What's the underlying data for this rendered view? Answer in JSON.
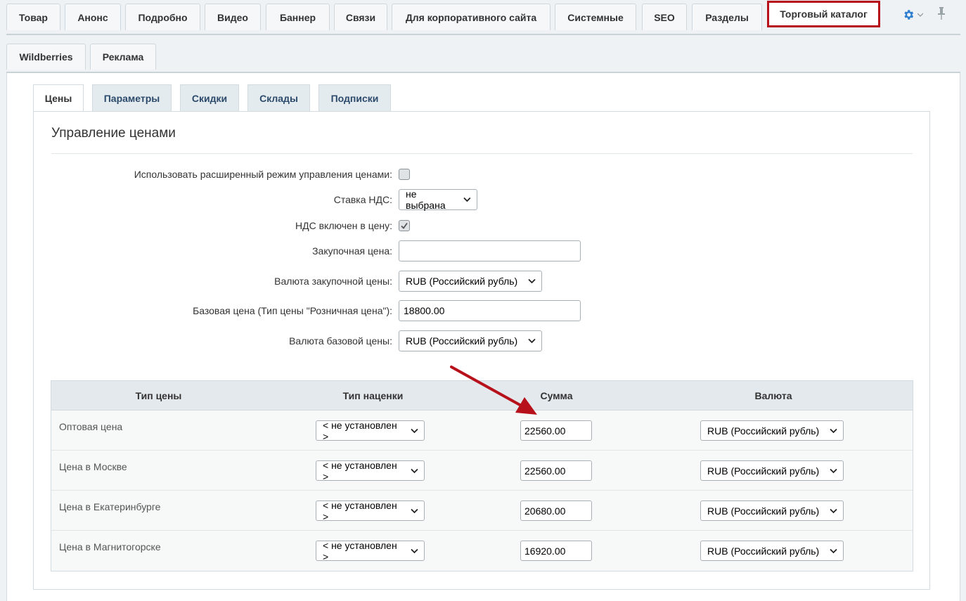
{
  "top_tabs": [
    "Товар",
    "Анонс",
    "Подробно",
    "Видео",
    "Баннер",
    "Связи",
    "Для корпоративного сайта",
    "Системные",
    "SEO",
    "Разделы",
    "Торговый каталог"
  ],
  "second_tabs": [
    "Wildberries",
    "Реклама"
  ],
  "sub_tabs": [
    "Цены",
    "Параметры",
    "Скидки",
    "Склады",
    "Подписки"
  ],
  "section_title": "Управление ценами",
  "fields": {
    "extended_mode_label": "Использовать расширенный режим управления ценами:",
    "extended_mode_checked": false,
    "vat_rate_label": "Ставка НДС:",
    "vat_rate_value": "не выбрана",
    "vat_included_label": "НДС включен в цену:",
    "vat_included_checked": true,
    "purchase_price_label": "Закупочная цена:",
    "purchase_price_value": "",
    "purchase_currency_label": "Валюта закупочной цены:",
    "purchase_currency_value": "RUB (Российский рубль)",
    "base_price_label": "Базовая цена (Тип цены \"Розничная цена\"):",
    "base_price_value": "18800.00",
    "base_currency_label": "Валюта базовой цены:",
    "base_currency_value": "RUB (Российский рубль)"
  },
  "price_table": {
    "headers": [
      "Тип цены",
      "Тип наценки",
      "Сумма",
      "Валюта"
    ],
    "rows": [
      {
        "name": "Оптовая цена",
        "markup": "< не установлен >",
        "amount": "22560.00",
        "currency": "RUB (Российский рубль)"
      },
      {
        "name": "Цена в Москве",
        "markup": "< не установлен >",
        "amount": "22560.00",
        "currency": "RUB (Российский рубль)"
      },
      {
        "name": "Цена в Екатеринбурге",
        "markup": "< не установлен >",
        "amount": "20680.00",
        "currency": "RUB (Российский рубль)"
      },
      {
        "name": "Цена в Магнитогорске",
        "markup": "< не установлен >",
        "amount": "16920.00",
        "currency": "RUB (Российский рубль)"
      }
    ]
  },
  "colors": {
    "highlight": "#b7121c",
    "arrow": "#b7121c",
    "gear": "#2f7fd0"
  },
  "icons": [
    "gear-icon",
    "pin-icon",
    "chevron-down-icon",
    "check-icon",
    "arrow-annotation-icon"
  ]
}
